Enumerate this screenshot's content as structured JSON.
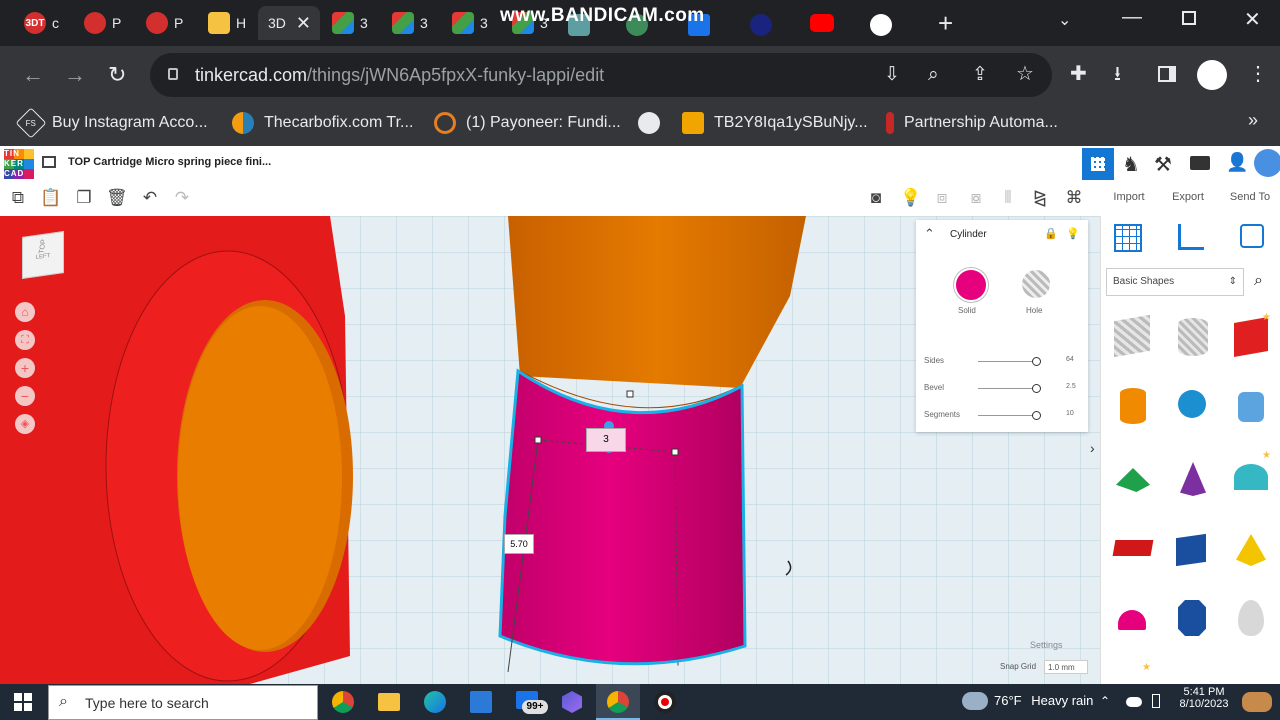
{
  "browser": {
    "tabs": [
      {
        "label": "c",
        "icon_text": "3DT",
        "icon_color": "#d32f2f"
      },
      {
        "label": "P",
        "icon_text": "",
        "icon_color": "#d32f2f"
      },
      {
        "label": "P",
        "icon_text": "",
        "icon_color": "#d32f2f"
      },
      {
        "label": "H",
        "icon_text": "",
        "icon_color": "#f5c242"
      },
      {
        "label": "3D",
        "icon_text": "",
        "icon_color": "#35363a",
        "active": true
      },
      {
        "label": "3",
        "icon_text": "",
        "icon_color": "#ffffff"
      },
      {
        "label": "3",
        "icon_text": "",
        "icon_color": "#ffffff"
      },
      {
        "label": "3",
        "icon_text": "",
        "icon_color": "#ffffff"
      },
      {
        "label": "3",
        "icon_text": "",
        "icon_color": "#ffffff"
      }
    ],
    "watermark": "www.BANDICAM.com",
    "url_host": "tinkercad.com",
    "url_path": "/things/jWN6Ap5fpxX-funky-lappi/edit",
    "bookmarks": [
      {
        "label": "Buy Instagram Acco...",
        "icon_text": "FS"
      },
      {
        "label": "Thecarbofix.com Tr...",
        "icon_text": ""
      },
      {
        "label": "(1) Payoneer: Fundi...",
        "icon_text": ""
      },
      {
        "label": "",
        "icon_text": ""
      },
      {
        "label": "TB2Y8Iqa1ySBuNjy...",
        "icon_text": ""
      },
      {
        "label": "Partnership Automa...",
        "icon_text": ""
      }
    ],
    "more_bookmarks": "»"
  },
  "tinkercad": {
    "logo_letters": [
      "TIN",
      "KER",
      "CAD"
    ],
    "design_title": "TOP Cartridge Micro spring piece fini...",
    "import_label": "Import",
    "export_label": "Export",
    "sendto_label": "Send To",
    "viewcube_top": "TOP",
    "viewcube_left": "LEFT",
    "dimension_height": "3",
    "dimension_side": "5.70",
    "inspector": {
      "title": "Cylinder",
      "solid_label": "Solid",
      "hole_label": "Hole",
      "solid_color": "#e6007e",
      "params": [
        {
          "label": "Sides",
          "value": "64"
        },
        {
          "label": "Bevel",
          "value": "2.5"
        },
        {
          "label": "Segments",
          "value": "10"
        }
      ]
    },
    "library_dropdown": "Basic Shapes",
    "settings_label": "Settings",
    "snap_grid_label": "Snap Grid",
    "snap_grid_value": "1.0 mm"
  },
  "taskbar": {
    "search_placeholder": "Type here to search",
    "weather_temp": "76°F",
    "weather_desc": "Heavy rain",
    "time": "5:41 PM",
    "date": "8/10/2023",
    "store_badge": "99+"
  }
}
